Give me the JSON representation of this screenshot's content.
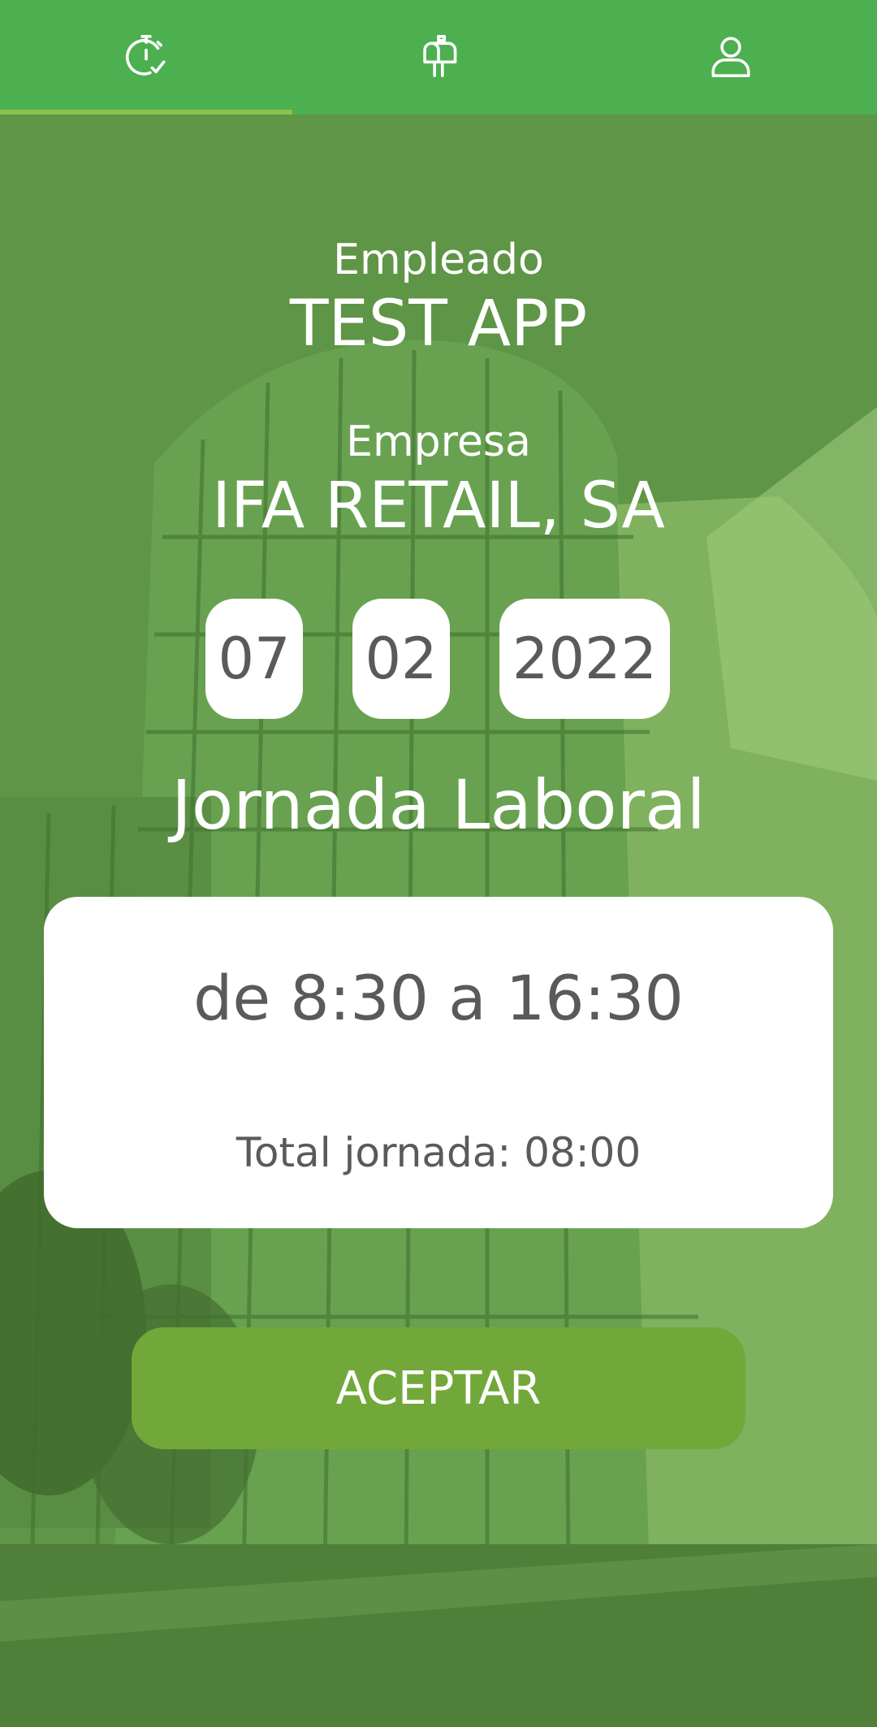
{
  "nav": {
    "tabs": [
      {
        "icon": "stopwatch-check-icon",
        "active": true
      },
      {
        "icon": "mailbox-icon",
        "active": false
      },
      {
        "icon": "user-icon",
        "active": false
      }
    ],
    "colors": {
      "bar": "#4caf50",
      "active_indicator": "#8bc34a"
    }
  },
  "employee": {
    "label": "Empleado",
    "name": "TEST APP"
  },
  "company": {
    "label": "Empresa",
    "name": "IFA RETAIL, SA"
  },
  "date": {
    "day": "07",
    "month": "02",
    "year": "2022"
  },
  "workday": {
    "title": "Jornada Laboral",
    "hours": "de 8:30 a 16:30",
    "total": "Total jornada: 08:00"
  },
  "accept_button": {
    "label": "ACEPTAR",
    "color": "#72a83a"
  }
}
